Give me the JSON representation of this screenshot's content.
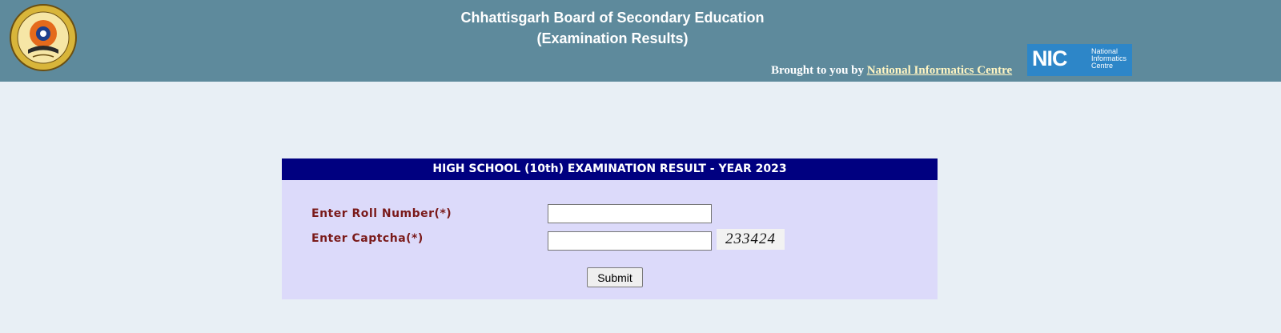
{
  "header": {
    "title_line1": "Chhattisgarh Board of Secondary Education",
    "title_line2": "(Examination Results)",
    "brought_prefix": "Brought to you by",
    "brought_link": "National Informatics Centre",
    "nic_letters": "NIC",
    "nic_name_line1": "National",
    "nic_name_line2": "Informatics",
    "nic_name_line3": "Centre",
    "board_logo_icon": "cgbse-emblem-icon",
    "nic_logo_icon": "nic-logo-icon",
    "colors": {
      "background": "#5e8a9c",
      "text": "#ffffff",
      "link": "#fff5c2",
      "nic_blue": "#2d86c8"
    }
  },
  "form": {
    "title": "HIGH SCHOOL (10th) EXAMINATION RESULT - YEAR 2023",
    "roll_label": "Enter Roll Number(*)",
    "roll_value": "",
    "captcha_label": "Enter Captcha(*)",
    "captcha_value": "",
    "captcha_code": "233424",
    "submit_label": "Submit",
    "colors": {
      "title_bar": "#000080",
      "panel": "#dcdafa",
      "label": "#7a1a1a"
    }
  }
}
